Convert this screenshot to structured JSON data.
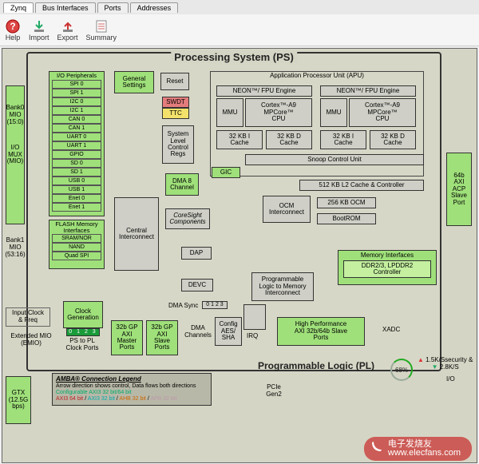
{
  "tabs": {
    "zynq": "Zynq",
    "bus": "Bus Interfaces",
    "ports": "Ports",
    "addresses": "Addresses"
  },
  "toolbar": {
    "help": "Help",
    "import": "Import",
    "export": "Export",
    "summary": "Summary"
  },
  "titles": {
    "ps": "Processing System (PS)",
    "pl": "Programmable Logic (PL)"
  },
  "io_periph_label": "I/O Peripherals",
  "peripherals": [
    {
      "label": "SPI 0",
      "cls": "gray"
    },
    {
      "label": "SPI 1",
      "cls": "gray"
    },
    {
      "label": "I2C 0",
      "cls": "cyan"
    },
    {
      "label": "I2C 1",
      "cls": "gray"
    },
    {
      "label": "CAN 0",
      "cls": "yellow"
    },
    {
      "label": "CAN 1",
      "cls": "gray"
    },
    {
      "label": "UART 0",
      "cls": "gray"
    },
    {
      "label": "UART 1",
      "cls": "blue"
    },
    {
      "label": "GPIO",
      "cls": "lightgreen"
    },
    {
      "label": "SD 0",
      "cls": "teal"
    },
    {
      "label": "SD 1",
      "cls": "gray"
    },
    {
      "label": "USB 0",
      "cls": "green"
    },
    {
      "label": "USB 1",
      "cls": "gray"
    },
    {
      "label": "Enet 0",
      "cls": "pink"
    },
    {
      "label": "Enet 1",
      "cls": "gray"
    }
  ],
  "flash_label": "FLASH Memory Interfaces",
  "flash_items": [
    {
      "label": "SRAM/NOR",
      "cls": "darkgrey"
    },
    {
      "label": "NAND",
      "cls": "gray"
    },
    {
      "label": "Quad SPI",
      "cls": "gray"
    }
  ],
  "side": {
    "bank0": "Bank0\nMIO\n(15:0)",
    "iomux": "I/O\nMUX\n(MIO)",
    "bank1": "Bank1\nMIO\n(53:16)",
    "acp": "64b\nAXI\nACP\nSlave\nPort"
  },
  "blocks": {
    "general": "General\nSettings",
    "reset": "Reset",
    "swdt": "SWDT",
    "ttc": "TTC",
    "sysregs": "System\nLevel\nControl\nRegs",
    "apu": "Application Processor Unit (APU)",
    "neon1": "NEON™/ FPU Engine",
    "neon2": "NEON™/ FPU Engine",
    "mmu": "MMU",
    "cpu": "Cortex™-A9\nMPCore™\nCPU",
    "icache": "32 KB I\nCache",
    "dcache": "32 KB D\nCache",
    "snoop": "Snoop Control Unit",
    "l2": "512 KB L2 Cache & Controller",
    "ocm_ic": "OCM\nInterconnect",
    "ocm": "256 KB OCM",
    "bootrom": "BootROM",
    "gic": "GIC",
    "dma8": "DMA 8\nChannel",
    "coresight": "CoreSight\nComponents",
    "central": "Central\nInterconnect",
    "dap": "DAP",
    "devc": "DEVC",
    "plmem": "Programmable\nLogic to Memory\nInterconnect",
    "memif": "Memory Interfaces",
    "ddr": "DDR2/3, LPDDR2\nController",
    "clockgen": "Clock\nGeneration",
    "pstopl": "PS to PL\nClock Ports",
    "dmasync": "DMA Sync",
    "dmasync012": "0 1 2 3",
    "dmachannels": "DMA\nChannels",
    "gp_master": "32b GP\nAXI\nMaster\nPorts",
    "gp_slave": "32b GP\nAXI\nSlave\nPorts",
    "aes": "Config\nAES/\nSHA",
    "irq": "IRQ",
    "hp": "High Performance\nAXI 32b/64b Slave\nPorts",
    "xadc": "XADC",
    "ext_mio": "Extended MIO\n(EMIO)",
    "inclk": "Input Clock\n& Freq",
    "gtx": "GTX\n(12.5G\nbps)",
    "pcie": "PCIe\nGen2",
    "io": "I/O",
    "pstopl_ports": "0 1 2 3"
  },
  "legend": {
    "title": "AMBA® Connection Legend",
    "desc": "Arrow direction shows control, Data flows both directions",
    "l1": "Configurable AXI3 32 bit/64 bit",
    "l2": "AXI3 64 bit",
    "l3": "AXI3 32 bit",
    "l4": "AHB 32 bit",
    "l5": "APB 32 bit"
  },
  "stats": {
    "percent": "68%",
    "r1": "1.5K/S",
    "r2": "2.8K/S"
  },
  "watermark": "电子发烧友\nwww.elecfans.com"
}
